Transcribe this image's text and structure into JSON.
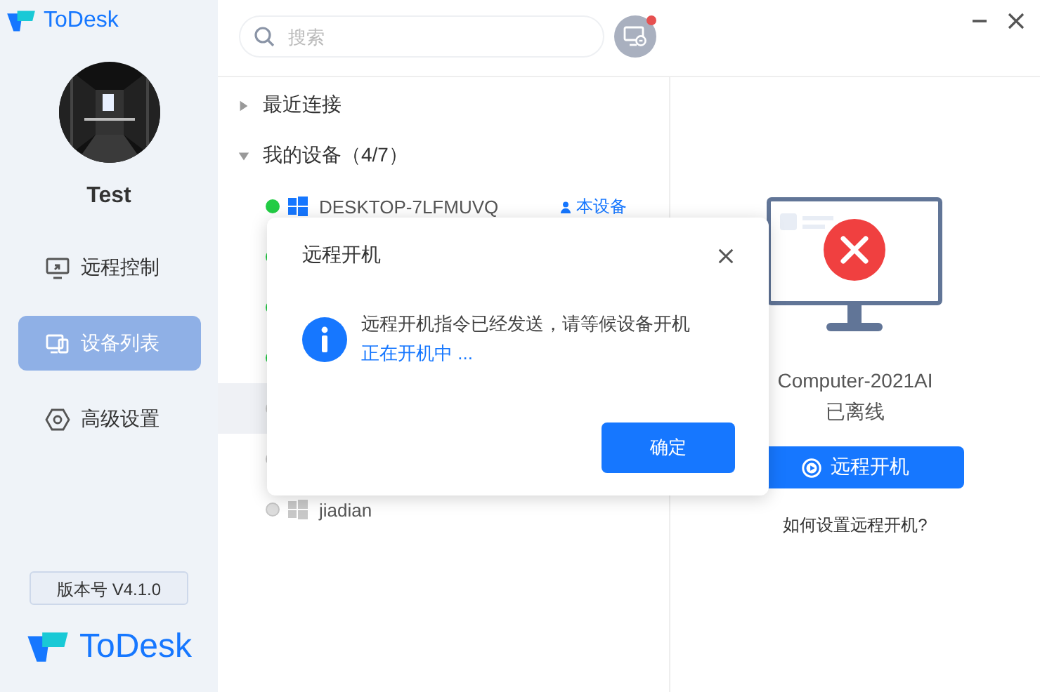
{
  "app": {
    "logo": "ToDesk"
  },
  "user": {
    "name": "Test"
  },
  "nav": [
    {
      "label": "远程控制",
      "kind": "remote",
      "selected": false
    },
    {
      "label": "设备列表",
      "kind": "devices",
      "selected": true
    },
    {
      "label": "高级设置",
      "kind": "settings",
      "selected": false
    }
  ],
  "version": "版本号 V4.1.0",
  "footer_logo": "ToDesk",
  "search": {
    "placeholder": "搜索"
  },
  "notification": {
    "unread": true
  },
  "groups": [
    {
      "label": "最近连接",
      "expanded": false
    },
    {
      "label": "我的设备（4/7）",
      "expanded": true
    }
  ],
  "devices": [
    {
      "name": "DESKTOP-7LFMUVQ",
      "online": true,
      "tag": "本设备",
      "selected": false
    },
    {
      "online": true,
      "selected": false
    },
    {
      "online": true,
      "selected": false
    },
    {
      "online": true,
      "selected": false
    },
    {
      "online": false,
      "selected": true
    },
    {
      "online": false,
      "selected": false
    },
    {
      "name": "jiadian",
      "online": false,
      "selected": false
    }
  ],
  "detail": {
    "name": "Computer-2021AI",
    "status": "已离线",
    "online": false,
    "action": "远程开机",
    "help": "如何设置远程开机?"
  },
  "dialog": {
    "title": "远程开机",
    "message": "远程开机指令已经发送，请等候设备开机",
    "progress": "正在开机中 ...",
    "confirm": "确定"
  }
}
